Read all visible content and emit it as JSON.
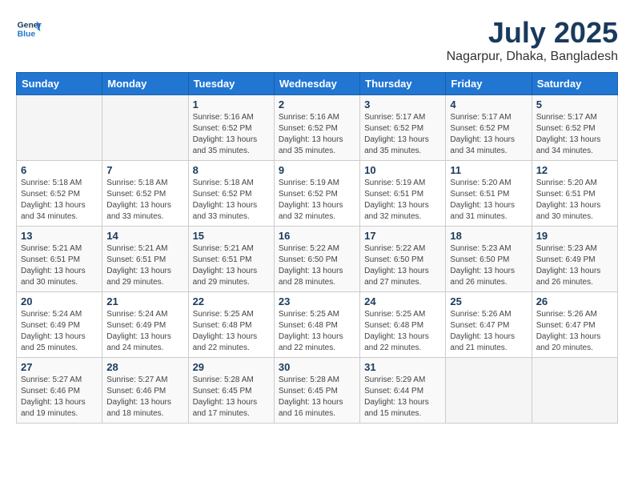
{
  "header": {
    "logo_line1": "General",
    "logo_line2": "Blue",
    "month": "July 2025",
    "location": "Nagarpur, Dhaka, Bangladesh"
  },
  "weekdays": [
    "Sunday",
    "Monday",
    "Tuesday",
    "Wednesday",
    "Thursday",
    "Friday",
    "Saturday"
  ],
  "weeks": [
    [
      {
        "day": "",
        "text": ""
      },
      {
        "day": "",
        "text": ""
      },
      {
        "day": "1",
        "text": "Sunrise: 5:16 AM\nSunset: 6:52 PM\nDaylight: 13 hours\nand 35 minutes."
      },
      {
        "day": "2",
        "text": "Sunrise: 5:16 AM\nSunset: 6:52 PM\nDaylight: 13 hours\nand 35 minutes."
      },
      {
        "day": "3",
        "text": "Sunrise: 5:17 AM\nSunset: 6:52 PM\nDaylight: 13 hours\nand 35 minutes."
      },
      {
        "day": "4",
        "text": "Sunrise: 5:17 AM\nSunset: 6:52 PM\nDaylight: 13 hours\nand 34 minutes."
      },
      {
        "day": "5",
        "text": "Sunrise: 5:17 AM\nSunset: 6:52 PM\nDaylight: 13 hours\nand 34 minutes."
      }
    ],
    [
      {
        "day": "6",
        "text": "Sunrise: 5:18 AM\nSunset: 6:52 PM\nDaylight: 13 hours\nand 34 minutes."
      },
      {
        "day": "7",
        "text": "Sunrise: 5:18 AM\nSunset: 6:52 PM\nDaylight: 13 hours\nand 33 minutes."
      },
      {
        "day": "8",
        "text": "Sunrise: 5:18 AM\nSunset: 6:52 PM\nDaylight: 13 hours\nand 33 minutes."
      },
      {
        "day": "9",
        "text": "Sunrise: 5:19 AM\nSunset: 6:52 PM\nDaylight: 13 hours\nand 32 minutes."
      },
      {
        "day": "10",
        "text": "Sunrise: 5:19 AM\nSunset: 6:51 PM\nDaylight: 13 hours\nand 32 minutes."
      },
      {
        "day": "11",
        "text": "Sunrise: 5:20 AM\nSunset: 6:51 PM\nDaylight: 13 hours\nand 31 minutes."
      },
      {
        "day": "12",
        "text": "Sunrise: 5:20 AM\nSunset: 6:51 PM\nDaylight: 13 hours\nand 30 minutes."
      }
    ],
    [
      {
        "day": "13",
        "text": "Sunrise: 5:21 AM\nSunset: 6:51 PM\nDaylight: 13 hours\nand 30 minutes."
      },
      {
        "day": "14",
        "text": "Sunrise: 5:21 AM\nSunset: 6:51 PM\nDaylight: 13 hours\nand 29 minutes."
      },
      {
        "day": "15",
        "text": "Sunrise: 5:21 AM\nSunset: 6:51 PM\nDaylight: 13 hours\nand 29 minutes."
      },
      {
        "day": "16",
        "text": "Sunrise: 5:22 AM\nSunset: 6:50 PM\nDaylight: 13 hours\nand 28 minutes."
      },
      {
        "day": "17",
        "text": "Sunrise: 5:22 AM\nSunset: 6:50 PM\nDaylight: 13 hours\nand 27 minutes."
      },
      {
        "day": "18",
        "text": "Sunrise: 5:23 AM\nSunset: 6:50 PM\nDaylight: 13 hours\nand 26 minutes."
      },
      {
        "day": "19",
        "text": "Sunrise: 5:23 AM\nSunset: 6:49 PM\nDaylight: 13 hours\nand 26 minutes."
      }
    ],
    [
      {
        "day": "20",
        "text": "Sunrise: 5:24 AM\nSunset: 6:49 PM\nDaylight: 13 hours\nand 25 minutes."
      },
      {
        "day": "21",
        "text": "Sunrise: 5:24 AM\nSunset: 6:49 PM\nDaylight: 13 hours\nand 24 minutes."
      },
      {
        "day": "22",
        "text": "Sunrise: 5:25 AM\nSunset: 6:48 PM\nDaylight: 13 hours\nand 22 minutes."
      },
      {
        "day": "23",
        "text": "Sunrise: 5:25 AM\nSunset: 6:48 PM\nDaylight: 13 hours\nand 22 minutes."
      },
      {
        "day": "24",
        "text": "Sunrise: 5:25 AM\nSunset: 6:48 PM\nDaylight: 13 hours\nand 22 minutes."
      },
      {
        "day": "25",
        "text": "Sunrise: 5:26 AM\nSunset: 6:47 PM\nDaylight: 13 hours\nand 21 minutes."
      },
      {
        "day": "26",
        "text": "Sunrise: 5:26 AM\nSunset: 6:47 PM\nDaylight: 13 hours\nand 20 minutes."
      }
    ],
    [
      {
        "day": "27",
        "text": "Sunrise: 5:27 AM\nSunset: 6:46 PM\nDaylight: 13 hours\nand 19 minutes."
      },
      {
        "day": "28",
        "text": "Sunrise: 5:27 AM\nSunset: 6:46 PM\nDaylight: 13 hours\nand 18 minutes."
      },
      {
        "day": "29",
        "text": "Sunrise: 5:28 AM\nSunset: 6:45 PM\nDaylight: 13 hours\nand 17 minutes."
      },
      {
        "day": "30",
        "text": "Sunrise: 5:28 AM\nSunset: 6:45 PM\nDaylight: 13 hours\nand 16 minutes."
      },
      {
        "day": "31",
        "text": "Sunrise: 5:29 AM\nSunset: 6:44 PM\nDaylight: 13 hours\nand 15 minutes."
      },
      {
        "day": "",
        "text": ""
      },
      {
        "day": "",
        "text": ""
      }
    ]
  ]
}
